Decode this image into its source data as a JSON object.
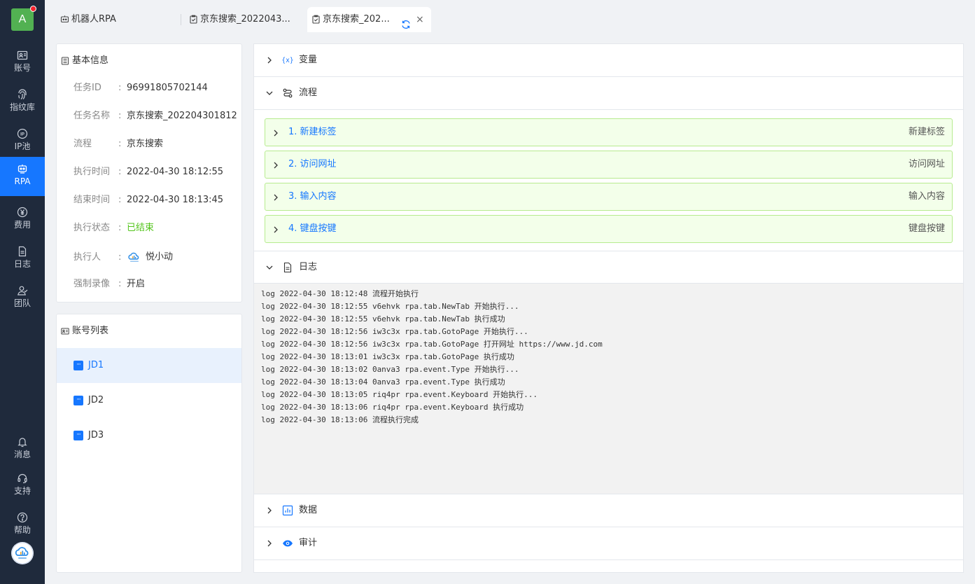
{
  "sidebar": {
    "avatar_letter": "A",
    "items": [
      {
        "label": "账号",
        "icon": "id-card-icon"
      },
      {
        "label": "指纹库",
        "icon": "fingerprint-icon"
      },
      {
        "label": "IP池",
        "icon": "ip-icon"
      },
      {
        "label": "RPA",
        "icon": "robot-icon"
      },
      {
        "label": "费用",
        "icon": "yen-icon"
      },
      {
        "label": "日志",
        "icon": "document-icon"
      },
      {
        "label": "团队",
        "icon": "team-icon"
      }
    ],
    "bottom_items": [
      {
        "label": "消息",
        "icon": "bell-icon"
      },
      {
        "label": "支持",
        "icon": "headset-icon"
      },
      {
        "label": "帮助",
        "icon": "help-icon"
      }
    ]
  },
  "tabs": [
    {
      "label": "机器人RPA"
    },
    {
      "label": "京东搜索_2022043..."
    },
    {
      "label": "京东搜索_202..."
    }
  ],
  "basic_info": {
    "title": "基本信息",
    "rows": [
      {
        "key": "任务ID",
        "value": "96991805702144"
      },
      {
        "key": "任务名称",
        "value": "京东搜索_202204301812"
      },
      {
        "key": "流程",
        "value": "京东搜索"
      },
      {
        "key": "执行时间",
        "value": "2022-04-30 18:12:55"
      },
      {
        "key": "结束时间",
        "value": "2022-04-30 18:13:45"
      },
      {
        "key": "执行状态",
        "value": "已结束"
      },
      {
        "key": "执行人",
        "value": "悦小动"
      },
      {
        "key": "强制录像",
        "value": "开启"
      }
    ],
    "colon": ":"
  },
  "account_list": {
    "title": "账号列表",
    "items": [
      "JD1",
      "JD2",
      "JD3"
    ]
  },
  "sections": {
    "variables": "变量",
    "flow": "流程",
    "log": "日志",
    "data": "数据",
    "audit": "审计"
  },
  "variables_icon_text": "{x}",
  "steps": [
    {
      "name": "1. 新建标签",
      "type": "新建标签"
    },
    {
      "name": "2. 访问网址",
      "type": "访问网址"
    },
    {
      "name": "3. 输入内容",
      "type": "输入内容"
    },
    {
      "name": "4. 键盘按键",
      "type": "键盘按键"
    }
  ],
  "log_lines": [
    "log 2022-04-30 18:12:48 流程开始执行",
    "log 2022-04-30 18:12:55 v6ehvk rpa.tab.NewTab 开始执行...",
    "log 2022-04-30 18:12:55 v6ehvk rpa.tab.NewTab 执行成功",
    "log 2022-04-30 18:12:56 iw3c3x rpa.tab.GotoPage 开始执行...",
    "log 2022-04-30 18:12:56 iw3c3x rpa.tab.GotoPage 打开网址 https://www.jd.com",
    "log 2022-04-30 18:13:01 iw3c3x rpa.tab.GotoPage 执行成功",
    "log 2022-04-30 18:13:02 0anva3 rpa.event.Type 开始执行...",
    "log 2022-04-30 18:13:04 0anva3 rpa.event.Type 执行成功",
    "log 2022-04-30 18:13:05 riq4pr rpa.event.Keyboard 开始执行...",
    "log 2022-04-30 18:13:06 riq4pr rpa.event.Keyboard 执行成功",
    "log 2022-04-30 18:13:06 流程执行完成"
  ],
  "colors": {
    "sidebar_bg": "#1f2a3c",
    "accent": "#1677ff",
    "status_green": "#52c41a",
    "step_bg": "#f3ffea",
    "step_border": "#b7eb8f"
  }
}
